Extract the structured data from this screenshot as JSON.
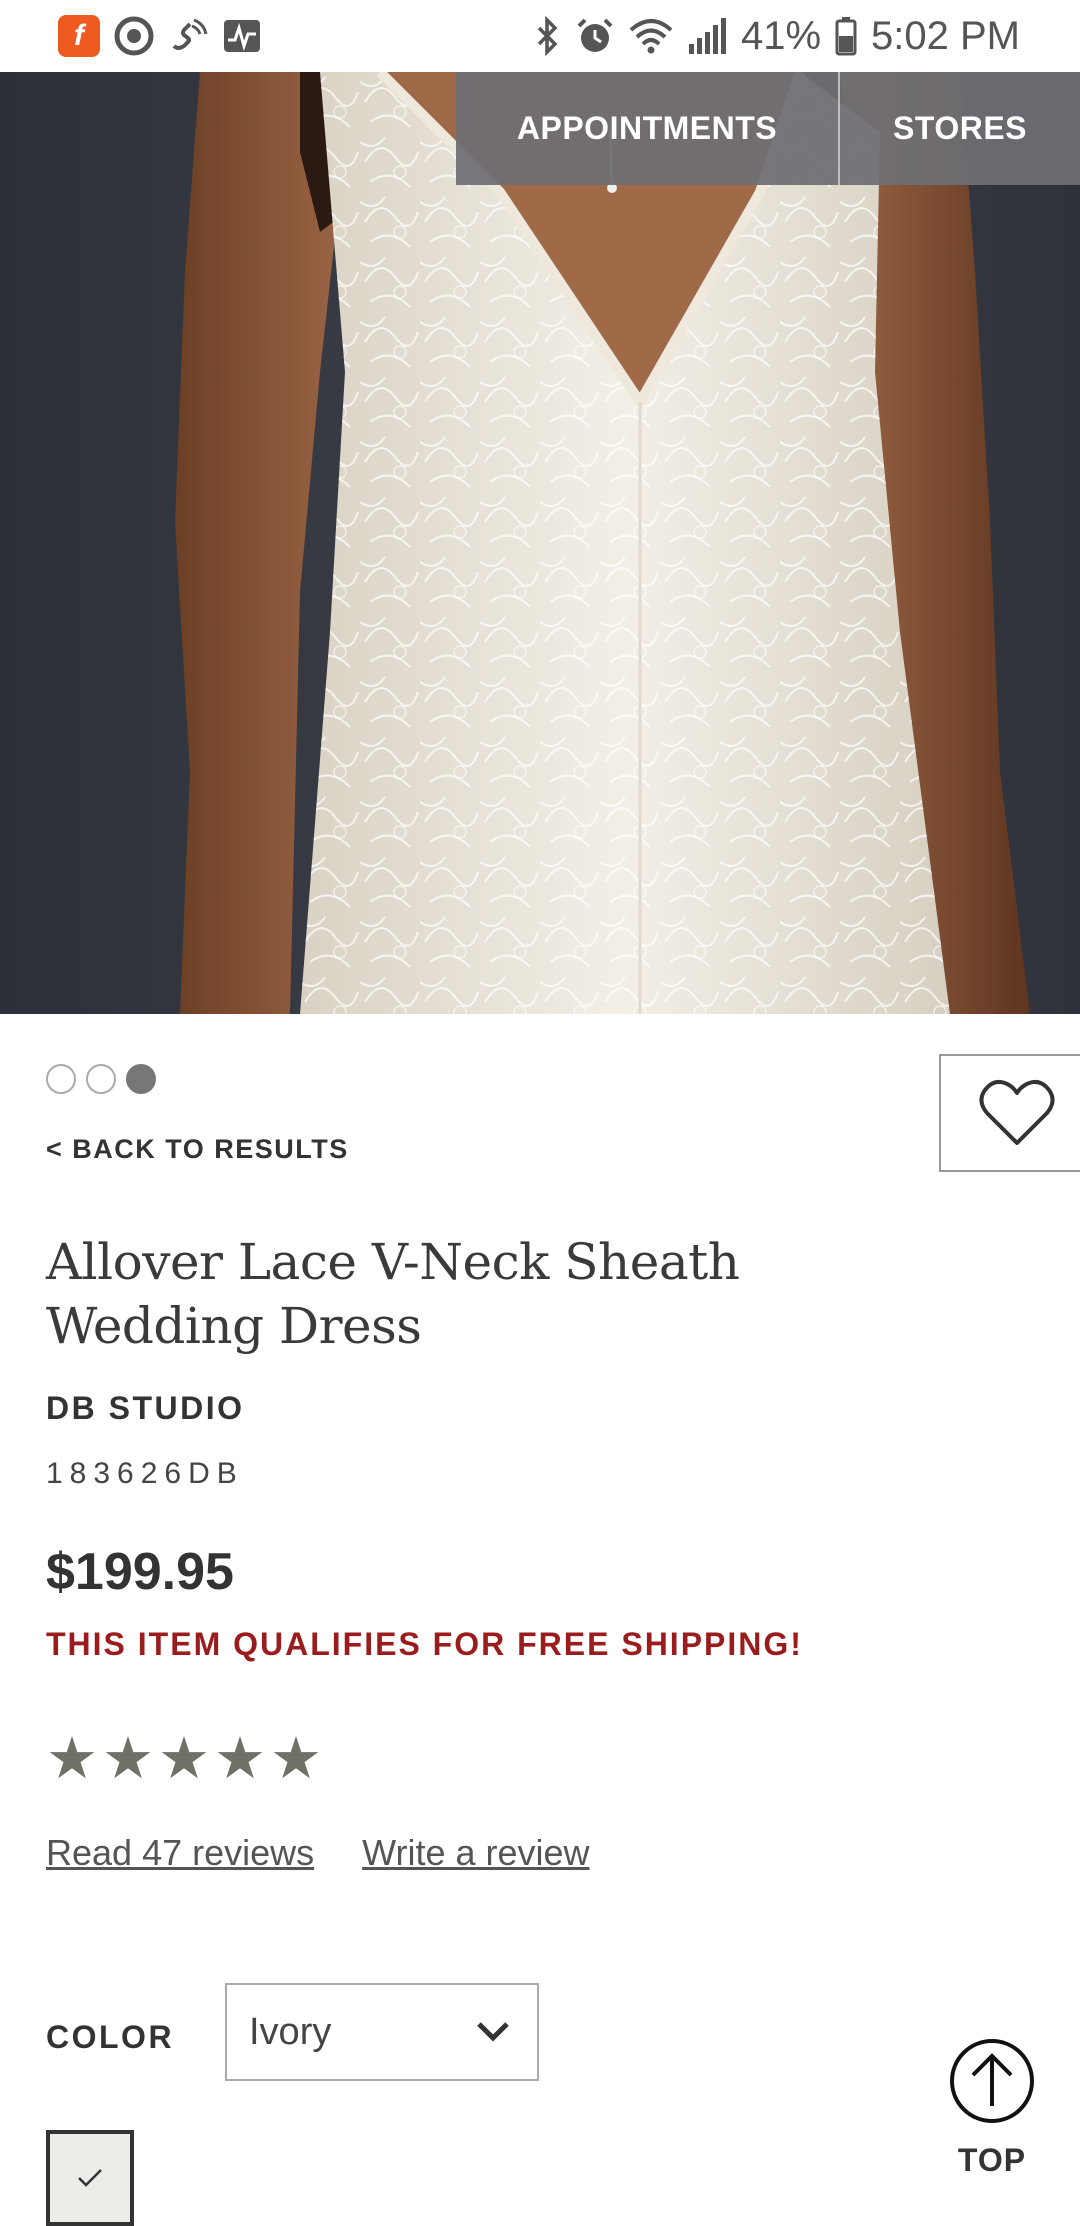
{
  "status_bar": {
    "battery": "41%",
    "time": "5:02 PM",
    "icons": [
      "app-f-icon",
      "target-icon",
      "wifi-call-icon",
      "activity-icon",
      "bluetooth-icon",
      "alarm-icon",
      "wifi-icon",
      "signal-icon",
      "battery-icon"
    ]
  },
  "app_icon_letter": "f",
  "nav": {
    "appointments": "APPOINTMENTS",
    "stores": "STORES"
  },
  "gallery": {
    "count": 3,
    "active_index": 2
  },
  "back_link": "< BACK TO RESULTS",
  "product": {
    "title": "Allover Lace V-Neck Sheath Wedding Dress",
    "brand": "DB STUDIO",
    "sku": "183626DB",
    "price": "$199.95",
    "shipping_note": "THIS ITEM QUALIFIES FOR FREE SHIPPING!",
    "rating": 4.8,
    "rating_max": 5
  },
  "reviews": {
    "read": "Read 47 reviews",
    "write": "Write a review"
  },
  "color": {
    "label": "COLOR",
    "selected": "Ivory"
  },
  "back_to_top": "TOP",
  "colors": {
    "shipping_red": "#9b1c1c",
    "star_gray": "#707066",
    "nav_bg": "#6e6e73"
  }
}
